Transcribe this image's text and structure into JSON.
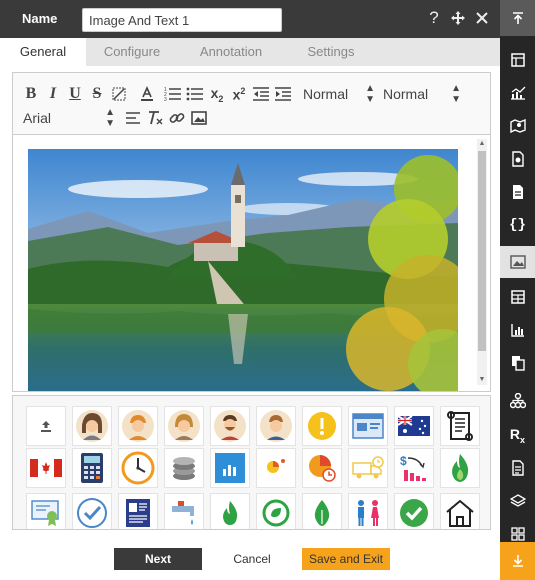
{
  "header": {
    "name_label": "Name",
    "name_value": "Image And Text 1",
    "icons": [
      "help-icon",
      "move-icon",
      "close-icon"
    ]
  },
  "tabs": [
    {
      "label": "General",
      "active": true
    },
    {
      "label": "Configure",
      "active": false
    },
    {
      "label": "Annotation",
      "active": false
    },
    {
      "label": "Settings",
      "active": false
    }
  ],
  "toolbar": {
    "buttons": [
      "bold",
      "italic",
      "underline",
      "strikethrough",
      "clear-background",
      "font-color",
      "ordered-list",
      "bullet-list",
      "subscript",
      "superscript",
      "outdent",
      "indent"
    ],
    "heading_select": "Normal",
    "size_select": "Normal",
    "font_select": "Arial",
    "row2_buttons": [
      "align",
      "clear-format",
      "link",
      "image"
    ]
  },
  "gallery": {
    "icons": [
      "upload-icon",
      "avatar-woman-1-icon",
      "avatar-man-orange-icon",
      "avatar-woman-2-icon",
      "avatar-man-beard-icon",
      "avatar-man-3-icon",
      "warning-circle-icon",
      "browser-window-icon",
      "australia-flag-icon",
      "scroll-icon",
      "canada-flag-icon",
      "calculator-icon",
      "clock-icon",
      "coins-icon",
      "bar-chart-icon",
      "pie-dot-icon",
      "pie-clock-icon",
      "delivery-truck-icon",
      "dollar-chart-icon",
      "flame-icon",
      "certificate-icon",
      "checkmark-circle-icon",
      "id-card-icon",
      "water-tap-icon",
      "flame-small-icon",
      "leaf-circle-icon",
      "leaf-drop-icon",
      "restroom-icon",
      "check-badge-icon",
      "house-icon"
    ]
  },
  "footer": {
    "next": "Next",
    "cancel": "Cancel",
    "save_exit": "Save and Exit"
  },
  "sidebar": {
    "items": [
      "scroll-top-icon",
      "grid-icon",
      "line-chart-icon",
      "map-icon",
      "file-settings-icon",
      "document-icon",
      "code-braces-icon",
      "image-text-icon",
      "table-icon",
      "bar-chart-icon",
      "copy-icon",
      "hierarchy-icon",
      "rx-icon",
      "report-icon",
      "layers-icon",
      "widgets-icon",
      "scroll-bottom-icon"
    ],
    "active": "image-text-icon"
  },
  "colors": {
    "header_bg": "#3a3a3a",
    "accent_orange": "#f7a21b",
    "sidebar_bg": "#262626"
  }
}
